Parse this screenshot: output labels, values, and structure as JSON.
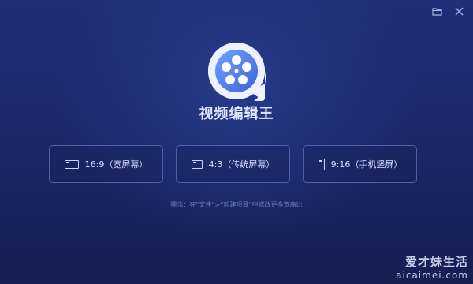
{
  "app": {
    "title": "视频编辑王",
    "logo_icon": "film-reel-icon",
    "accent_color": "#5a8cf0"
  },
  "window_controls": {
    "folder_icon": "folder-icon",
    "close_icon": "close-icon"
  },
  "aspect_ratios": [
    {
      "label": "16:9（宽屏幕）",
      "icon": "widescreen-frame-icon"
    },
    {
      "label": "4:3（传统屏幕）",
      "icon": "standard-frame-icon"
    },
    {
      "label": "9:16（手机竖屏）",
      "icon": "portrait-frame-icon"
    }
  ],
  "hint": "提示：在“文件”>“新建项目”中修改更多宽高比",
  "watermark": {
    "cn": "爱才妹生活",
    "en": "aicaimei.com"
  }
}
